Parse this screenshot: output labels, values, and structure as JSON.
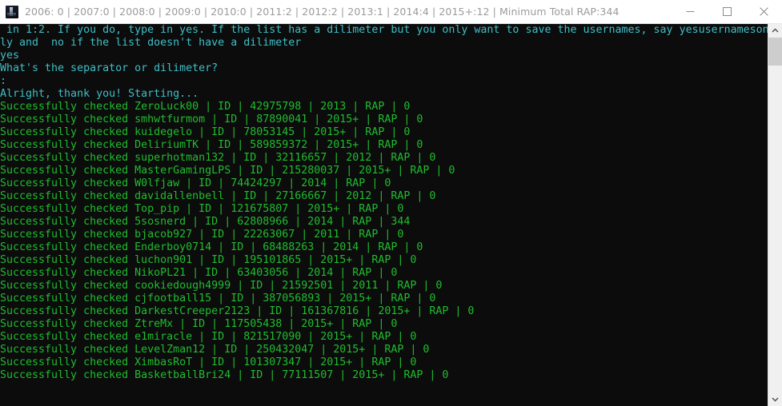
{
  "window": {
    "title": "2006: 0 | 2007:0 | 2008:0 | 2009:0 | 2010:0 | 2011:2 | 2012:2 | 2013:1 | 2014:4 | 2015+:12 | Minimum Total RAP:344",
    "icon": "python-console-icon",
    "minimize_label": "Minimize",
    "maximize_label": "Maximize",
    "close_label": "Close"
  },
  "title_stats": {
    "years": [
      {
        "label": "2006",
        "value": "0"
      },
      {
        "label": "2007",
        "value": "0"
      },
      {
        "label": "2008",
        "value": "0"
      },
      {
        "label": "2009",
        "value": "0"
      },
      {
        "label": "2010",
        "value": "0"
      },
      {
        "label": "2011",
        "value": "2"
      },
      {
        "label": "2012",
        "value": "2"
      },
      {
        "label": "2013",
        "value": "1"
      },
      {
        "label": "2014",
        "value": "4"
      },
      {
        "label": "2015+",
        "value": "12"
      }
    ],
    "minimum_total_rap_label": "Minimum Total RAP",
    "minimum_total_rap": "344"
  },
  "console": {
    "lines": [
      {
        "color": "cyan",
        "text": " in 1:2. If you do, type in yes. If the list has a dilimeter but you only want to save the usernames, say yesusernameson"
      },
      {
        "color": "cyan",
        "text": "ly and  no if the list doesn't have a dilimeter"
      },
      {
        "color": "cyan",
        "text": "yes"
      },
      {
        "color": "cyan",
        "text": "What's the separator or dilimeter?"
      },
      {
        "color": "cyan",
        "text": ":"
      },
      {
        "color": "cyan",
        "text": "Alright, thank you! Starting..."
      },
      {
        "color": "green",
        "text": "Successfully checked ZeroLuck00 | ID | 42975798 | 2013 | RAP | 0"
      },
      {
        "color": "green",
        "text": "Successfully checked smhwtfurmom | ID | 87890041 | 2015+ | RAP | 0"
      },
      {
        "color": "green",
        "text": "Successfully checked kuidegelo | ID | 78053145 | 2015+ | RAP | 0"
      },
      {
        "color": "green",
        "text": "Successfully checked DeliriumTK | ID | 589859372 | 2015+ | RAP | 0"
      },
      {
        "color": "green",
        "text": "Successfully checked superhotman132 | ID | 32116657 | 2012 | RAP | 0"
      },
      {
        "color": "green",
        "text": "Successfully checked MasterGamingLPS | ID | 215280037 | 2015+ | RAP | 0"
      },
      {
        "color": "green",
        "text": "Successfully checked W0lfjaw | ID | 74424297 | 2014 | RAP | 0"
      },
      {
        "color": "green",
        "text": "Successfully checked davidallenbell | ID | 27166667 | 2012 | RAP | 0"
      },
      {
        "color": "green",
        "text": "Successfully checked Top_pip | ID | 121675807 | 2015+ | RAP | 0"
      },
      {
        "color": "green",
        "text": "Successfully checked 5sosnerd | ID | 62808966 | 2014 | RAP | 344"
      },
      {
        "color": "green",
        "text": "Successfully checked bjacob927 | ID | 22263067 | 2011 | RAP | 0"
      },
      {
        "color": "green",
        "text": "Successfully checked Enderboy0714 | ID | 68488263 | 2014 | RAP | 0"
      },
      {
        "color": "green",
        "text": "Successfully checked luchon901 | ID | 195101865 | 2015+ | RAP | 0"
      },
      {
        "color": "green",
        "text": "Successfully checked NikoPL21 | ID | 63403056 | 2014 | RAP | 0"
      },
      {
        "color": "green",
        "text": "Successfully checked cookiedough4999 | ID | 21592501 | 2011 | RAP | 0"
      },
      {
        "color": "green",
        "text": "Successfully checked cjfootball15 | ID | 387056893 | 2015+ | RAP | 0"
      },
      {
        "color": "green",
        "text": "Successfully checked DarkestCreeper2123 | ID | 161367816 | 2015+ | RAP | 0"
      },
      {
        "color": "green",
        "text": "Successfully checked ZtreMx | ID | 117505438 | 2015+ | RAP | 0"
      },
      {
        "color": "green",
        "text": "Successfully checked e1miracle | ID | 821517090 | 2015+ | RAP | 0"
      },
      {
        "color": "green",
        "text": "Successfully checked LevelZman12 | ID | 250432047 | 2015+ | RAP | 0"
      },
      {
        "color": "green",
        "text": "Successfully checked XimbasRoT | ID | 101307347 | 2015+ | RAP | 0"
      },
      {
        "color": "green",
        "text": "Successfully checked BasketballBri24 | ID | 77111507 | 2015+ | RAP | 0"
      }
    ],
    "records": [
      {
        "username": "ZeroLuck00",
        "id": "42975798",
        "year": "2013",
        "rap": "0"
      },
      {
        "username": "smhwtfurmom",
        "id": "87890041",
        "year": "2015+",
        "rap": "0"
      },
      {
        "username": "kuidegelo",
        "id": "78053145",
        "year": "2015+",
        "rap": "0"
      },
      {
        "username": "DeliriumTK",
        "id": "589859372",
        "year": "2015+",
        "rap": "0"
      },
      {
        "username": "superhotman132",
        "id": "32116657",
        "year": "2012",
        "rap": "0"
      },
      {
        "username": "MasterGamingLPS",
        "id": "215280037",
        "year": "2015+",
        "rap": "0"
      },
      {
        "username": "W0lfjaw",
        "id": "74424297",
        "year": "2014",
        "rap": "0"
      },
      {
        "username": "davidallenbell",
        "id": "27166667",
        "year": "2012",
        "rap": "0"
      },
      {
        "username": "Top_pip",
        "id": "121675807",
        "year": "2015+",
        "rap": "0"
      },
      {
        "username": "5sosnerd",
        "id": "62808966",
        "year": "2014",
        "rap": "344"
      },
      {
        "username": "bjacob927",
        "id": "22263067",
        "year": "2011",
        "rap": "0"
      },
      {
        "username": "Enderboy0714",
        "id": "68488263",
        "year": "2014",
        "rap": "0"
      },
      {
        "username": "luchon901",
        "id": "195101865",
        "year": "2015+",
        "rap": "0"
      },
      {
        "username": "NikoPL21",
        "id": "63403056",
        "year": "2014",
        "rap": "0"
      },
      {
        "username": "cookiedough4999",
        "id": "21592501",
        "year": "2011",
        "rap": "0"
      },
      {
        "username": "cjfootball15",
        "id": "387056893",
        "year": "2015+",
        "rap": "0"
      },
      {
        "username": "DarkestCreeper2123",
        "id": "161367816",
        "year": "2015+",
        "rap": "0"
      },
      {
        "username": "ZtreMx",
        "id": "117505438",
        "year": "2015+",
        "rap": "0"
      },
      {
        "username": "e1miracle",
        "id": "821517090",
        "year": "2015+",
        "rap": "0"
      },
      {
        "username": "LevelZman12",
        "id": "250432047",
        "year": "2015+",
        "rap": "0"
      },
      {
        "username": "XimbasRoT",
        "id": "101307347",
        "year": "2015+",
        "rap": "0"
      },
      {
        "username": "BasketballBri24",
        "id": "77111507",
        "year": "2015+",
        "rap": "0"
      }
    ]
  },
  "colors": {
    "background": "#0c0c0c",
    "prompt_text": "#3fbfc7",
    "success_text": "#1fbd2e",
    "titlebar_background": "#ffffff",
    "titlebar_text": "#9b9b9b",
    "scrollbar_track": "#f0f0f0",
    "scrollbar_thumb": "#cdcdcd"
  },
  "scrollbar": {
    "up_arrow": "chevron-up-icon",
    "down_arrow": "chevron-down-icon",
    "thumb_position_percent": 0
  }
}
